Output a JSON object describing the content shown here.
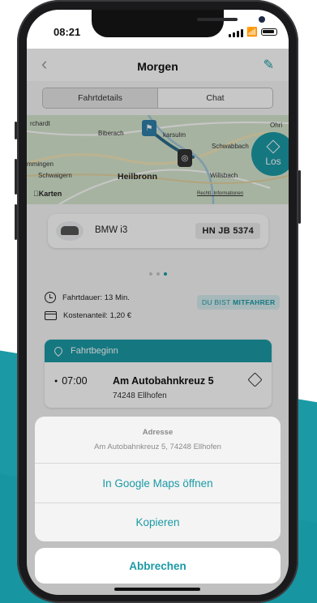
{
  "status_bar": {
    "time": "08:21"
  },
  "nav": {
    "title": "Morgen"
  },
  "tabs": [
    {
      "label": "Fahrtdetails",
      "selected": true
    },
    {
      "label": "Chat",
      "selected": false
    }
  ],
  "map": {
    "places": [
      "rchardt",
      "Biberach",
      "karsulm",
      "Schwabbach",
      "mmingen",
      "Schwaigern",
      "Heilbronn",
      "Willsbach",
      "Ohri"
    ],
    "start_button_label": "Los",
    "attribution": "Karten",
    "legal_link": "Rechtl. Informationen"
  },
  "vehicle": {
    "name": "BMW i3",
    "plate": "HN JB 5374"
  },
  "pager": {
    "count": 3,
    "active_index": 2
  },
  "trip_info": {
    "duration": "Fahrtdauer: 13 Min.",
    "cost_share": "Kostenanteil: 1,20 €",
    "role_prefix": "DU BIST",
    "role": "MITFAHRER"
  },
  "start_card": {
    "header": "Fahrtbeginn",
    "time": "07:00",
    "address": "Am Autobahnkreuz 5",
    "city": "74248 Ellhofen"
  },
  "action_sheet": {
    "title": "Adresse",
    "subtitle": "Am Autobahnkreuz 5, 74248 Ellhofen",
    "open_maps": "In Google Maps öffnen",
    "copy": "Kopieren",
    "cancel": "Abbrechen"
  },
  "colors": {
    "accent": "#1b9aa6",
    "badge_bg": "#d7ecef"
  },
  "icons": [
    "back-chevron-icon",
    "pencil-icon",
    "flag-icon",
    "map-pin-icon",
    "navigation-icon",
    "clock-icon",
    "wallet-icon",
    "location-pin-icon",
    "route-diamond-icon"
  ]
}
